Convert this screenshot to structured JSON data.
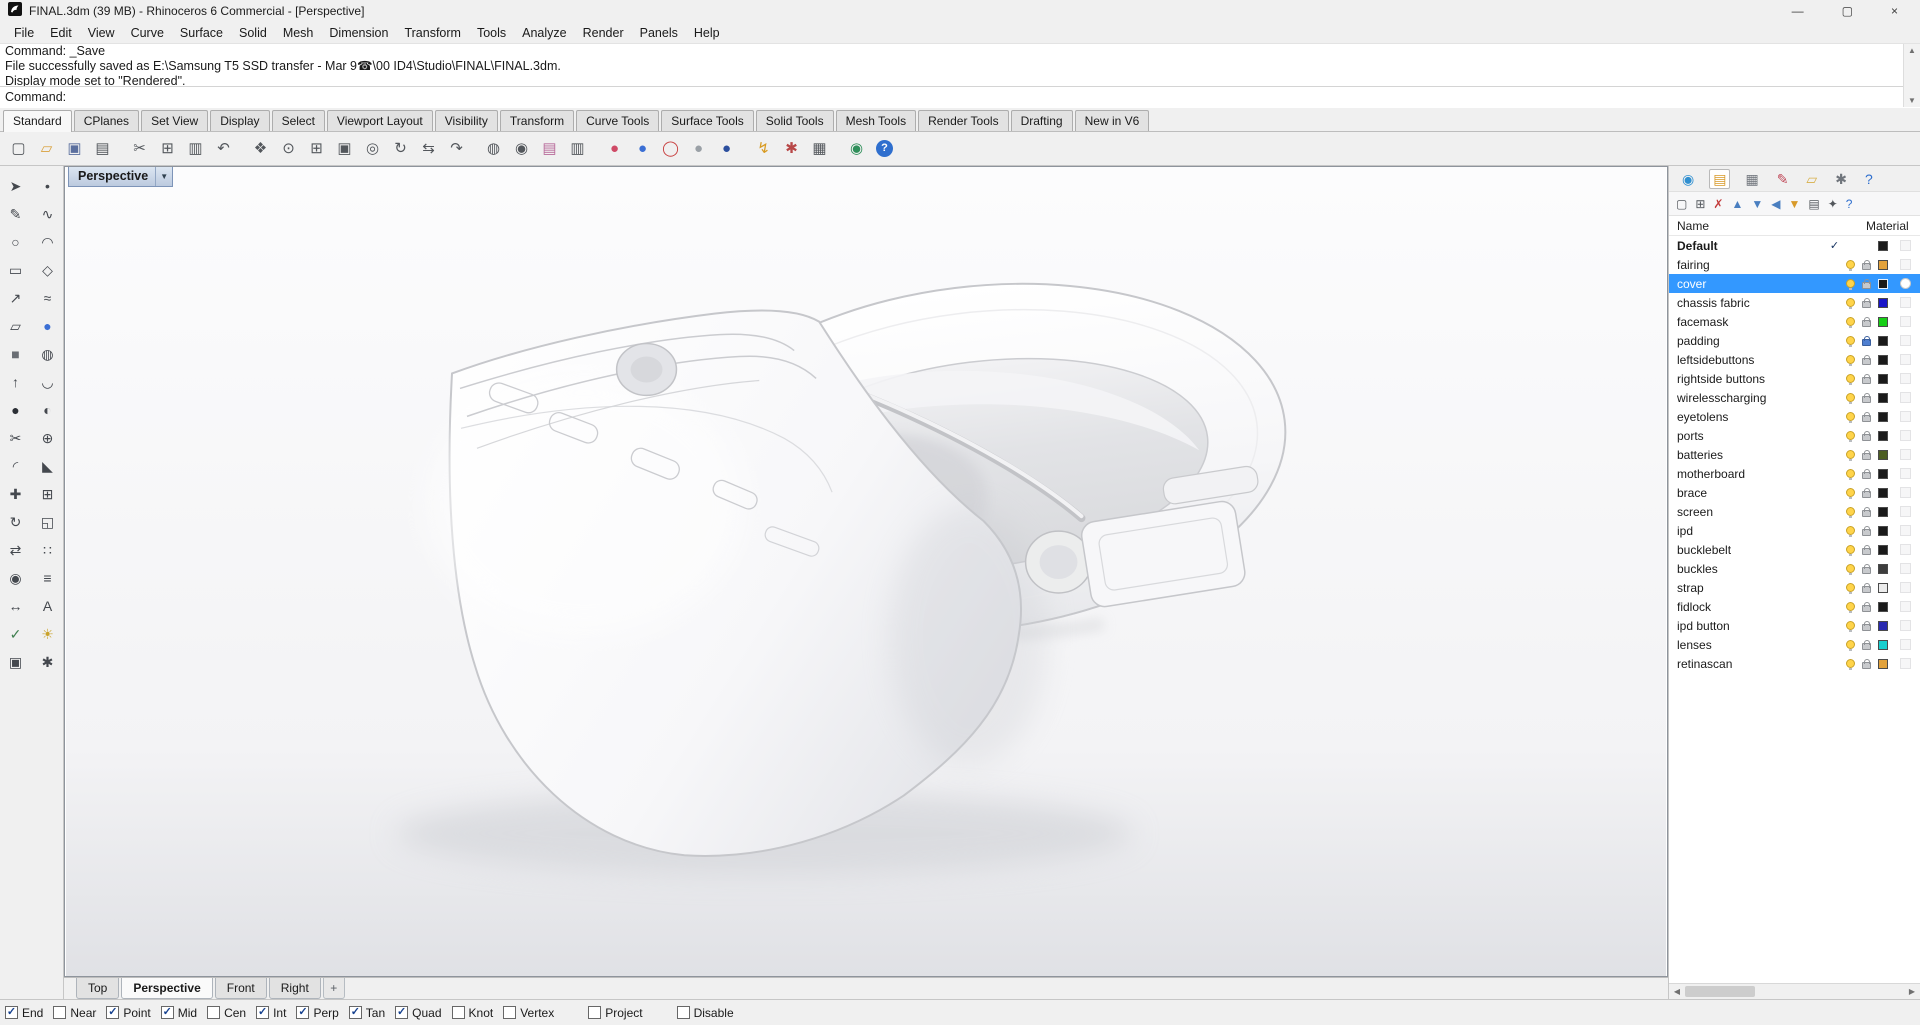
{
  "window": {
    "title": "FINAL.3dm (39 MB) - Rhinoceros 6 Commercial - [Perspective]",
    "minimize_glyph": "—",
    "maximize_glyph": "▢",
    "close_glyph": "×"
  },
  "menu": {
    "items": [
      {
        "name": "menu-file",
        "label": "File"
      },
      {
        "name": "menu-edit",
        "label": "Edit"
      },
      {
        "name": "menu-view",
        "label": "View"
      },
      {
        "name": "menu-curve",
        "label": "Curve"
      },
      {
        "name": "menu-surface",
        "label": "Surface"
      },
      {
        "name": "menu-solid",
        "label": "Solid"
      },
      {
        "name": "menu-mesh",
        "label": "Mesh"
      },
      {
        "name": "menu-dimension",
        "label": "Dimension"
      },
      {
        "name": "menu-transform",
        "label": "Transform"
      },
      {
        "name": "menu-tools",
        "label": "Tools"
      },
      {
        "name": "menu-analyze",
        "label": "Analyze"
      },
      {
        "name": "menu-render",
        "label": "Render"
      },
      {
        "name": "menu-panels",
        "label": "Panels"
      },
      {
        "name": "menu-help",
        "label": "Help"
      }
    ]
  },
  "command": {
    "history": [
      "Command: _Save",
      "File successfully saved as E:\\Samsung T5 SSD transfer - Mar 9☎\\00 ID4\\Studio\\FINAL\\FINAL.3dm.",
      "Display mode set to \"Rendered\"."
    ],
    "prompt": "Command:",
    "scroll_up_glyph": "▲",
    "scroll_down_glyph": "▼"
  },
  "tabbar": {
    "overflow_icon": "▦",
    "tabs": [
      {
        "name": "tab-standard",
        "label": "Standard",
        "active": true
      },
      {
        "name": "tab-cplanes",
        "label": "CPlanes"
      },
      {
        "name": "tab-set-view",
        "label": "Set View"
      },
      {
        "name": "tab-display",
        "label": "Display"
      },
      {
        "name": "tab-select",
        "label": "Select"
      },
      {
        "name": "tab-viewport-layout",
        "label": "Viewport Layout"
      },
      {
        "name": "tab-visibility",
        "label": "Visibility"
      },
      {
        "name": "tab-transform",
        "label": "Transform"
      },
      {
        "name": "tab-curve-tools",
        "label": "Curve Tools"
      },
      {
        "name": "tab-surface-tools",
        "label": "Surface Tools"
      },
      {
        "name": "tab-solid-tools",
        "label": "Solid Tools"
      },
      {
        "name": "tab-mesh-tools",
        "label": "Mesh Tools"
      },
      {
        "name": "tab-render-tools",
        "label": "Render Tools"
      },
      {
        "name": "tab-drafting",
        "label": "Drafting"
      },
      {
        "name": "tab-new-in-v6",
        "label": "New in V6"
      }
    ]
  },
  "toolbar": {
    "icons": [
      {
        "name": "new-file-icon",
        "glyph": "▢",
        "color": "#53575c"
      },
      {
        "name": "open-file-icon",
        "glyph": "▱",
        "color": "#d9a23e"
      },
      {
        "name": "save-file-icon",
        "glyph": "▣",
        "color": "#5b6f9e"
      },
      {
        "name": "print-icon",
        "glyph": "▤",
        "color": "#53575c"
      },
      {
        "name": "cut-icon",
        "glyph": "✂",
        "color": "#53575c",
        "sep": true
      },
      {
        "name": "copy-icon",
        "glyph": "⊞",
        "color": "#53575c"
      },
      {
        "name": "paste-icon",
        "glyph": "▥",
        "color": "#53575c"
      },
      {
        "name": "undo-icon",
        "glyph": "↶",
        "color": "#53575c"
      },
      {
        "name": "pan-icon",
        "glyph": "❖",
        "color": "#53575c",
        "sep": true
      },
      {
        "name": "zoom-dynamic-icon",
        "glyph": "⊙",
        "color": "#53575c"
      },
      {
        "name": "zoom-window-icon",
        "glyph": "⊞",
        "color": "#53575c"
      },
      {
        "name": "zoom-extents-icon",
        "glyph": "▣",
        "color": "#53575c"
      },
      {
        "name": "zoom-selected-icon",
        "glyph": "◎",
        "color": "#53575c"
      },
      {
        "name": "rotate-view-icon",
        "glyph": "↻",
        "color": "#53575c"
      },
      {
        "name": "pan-view-icon",
        "glyph": "⇆",
        "color": "#53575c"
      },
      {
        "name": "undo-view-icon",
        "glyph": "↷",
        "color": "#53575c"
      },
      {
        "name": "hide-objects-icon",
        "glyph": "◍",
        "color": "#53575c",
        "sep": true
      },
      {
        "name": "lock-objects-icon",
        "glyph": "◉",
        "color": "#53575c"
      },
      {
        "name": "layer-dialog-icon",
        "glyph": "▤",
        "color": "#b86a9a"
      },
      {
        "name": "object-properties-icon",
        "glyph": "▥",
        "color": "#53575c"
      },
      {
        "name": "render-icon",
        "glyph": "●",
        "color": "#cf4a66",
        "sep": true
      },
      {
        "name": "render-preview-icon",
        "glyph": "●",
        "color": "#3b6fd4"
      },
      {
        "name": "render-region-icon",
        "glyph": "◯",
        "color": "#c84040"
      },
      {
        "name": "shaded-mode-icon",
        "glyph": "●",
        "color": "#9aa0a6"
      },
      {
        "name": "ghosted-mode-icon",
        "glyph": "●",
        "color": "#2c4f9e"
      },
      {
        "name": "flash-render-icon",
        "glyph": "↯",
        "color": "#d89a20",
        "sep": true
      },
      {
        "name": "options-gear-icon",
        "glyph": "✱",
        "color": "#b84848"
      },
      {
        "name": "grid-snap-icon",
        "glyph": "▦",
        "color": "#53575c"
      },
      {
        "name": "web-browser-globe-icon",
        "glyph": "◉",
        "color": "#2f8f5a",
        "sep": true
      },
      {
        "name": "help-icon",
        "glyph": "?",
        "color": "#ffffff",
        "badge": true
      }
    ]
  },
  "left_toolbar": {
    "icons": [
      {
        "name": "select-icon",
        "glyph": "➤",
        "color": "#44484e"
      },
      {
        "name": "point-icon",
        "glyph": "•",
        "color": "#44484e"
      },
      {
        "name": "polyline-icon",
        "glyph": "✎",
        "color": "#44484e"
      },
      {
        "name": "curve-icon",
        "glyph": "∿",
        "color": "#44484e"
      },
      {
        "name": "circle-icon",
        "glyph": "○",
        "color": "#44484e"
      },
      {
        "name": "arc-icon",
        "glyph": "◠",
        "color": "#44484e"
      },
      {
        "name": "rectangle-icon",
        "glyph": "▭",
        "color": "#44484e"
      },
      {
        "name": "polygon-icon",
        "glyph": "◇",
        "color": "#44484e"
      },
      {
        "name": "curve-edit-icon",
        "glyph": "↗",
        "color": "#44484e"
      },
      {
        "name": "offset-icon",
        "glyph": "≈",
        "color": "#44484e"
      },
      {
        "name": "surface-icon",
        "glyph": "▱",
        "color": "#44484e"
      },
      {
        "name": "sphere-icon",
        "glyph": "●",
        "color": "#3b6fd4"
      },
      {
        "name": "box-icon",
        "glyph": "■",
        "color": "#6a6e74"
      },
      {
        "name": "cylinder-icon",
        "glyph": "◍",
        "color": "#44484e"
      },
      {
        "name": "extrude-icon",
        "glyph": "↑",
        "color": "#44484e"
      },
      {
        "name": "loft-icon",
        "glyph": "◡",
        "color": "#44484e"
      },
      {
        "name": "boolean-icon",
        "glyph": "●",
        "color": "#2b2f35"
      },
      {
        "name": "split-icon",
        "glyph": "◐",
        "color": "#44484e"
      },
      {
        "name": "trim-icon",
        "glyph": "✂",
        "color": "#44484e"
      },
      {
        "name": "join-icon",
        "glyph": "⊕",
        "color": "#44484e"
      },
      {
        "name": "fillet-icon",
        "glyph": "◜",
        "color": "#44484e"
      },
      {
        "name": "chamfer-icon",
        "glyph": "◣",
        "color": "#44484e"
      },
      {
        "name": "move-icon",
        "glyph": "✚",
        "color": "#44484e"
      },
      {
        "name": "copy-object-icon",
        "glyph": "⊞",
        "color": "#44484e"
      },
      {
        "name": "rotate-icon",
        "glyph": "↻",
        "color": "#44484e"
      },
      {
        "name": "scale-icon",
        "glyph": "◱",
        "color": "#44484e"
      },
      {
        "name": "mirror-icon",
        "glyph": "⇄",
        "color": "#44484e"
      },
      {
        "name": "array-icon",
        "glyph": "∷",
        "color": "#44484e"
      },
      {
        "name": "gumball-icon",
        "glyph": "◉",
        "color": "#44484e"
      },
      {
        "name": "align-icon",
        "glyph": "≡",
        "color": "#44484e"
      },
      {
        "name": "dimension-icon",
        "glyph": "↔",
        "color": "#44484e"
      },
      {
        "name": "text-icon",
        "glyph": "A",
        "color": "#44484e"
      },
      {
        "name": "visibility-check-icon",
        "glyph": "✓",
        "color": "#3f7f4f"
      },
      {
        "name": "lamp-icon",
        "glyph": "☀",
        "color": "#c9a22a"
      },
      {
        "name": "group-icon",
        "glyph": "▣",
        "color": "#44484e"
      },
      {
        "name": "explode-icon",
        "glyph": "✱",
        "color": "#44484e"
      }
    ]
  },
  "viewport": {
    "label": "Perspective",
    "dropdown_glyph": "▼"
  },
  "layers_panel": {
    "current_glyph": "✓",
    "columns": {
      "name": "Name",
      "material": "Material"
    },
    "panel_tabs": [
      {
        "name": "properties-tab",
        "glyph": "◉",
        "color": "#2f8fd0"
      },
      {
        "name": "layers-tab",
        "glyph": "▤",
        "color": "#d89a2a",
        "active": true
      },
      {
        "name": "display-tab",
        "glyph": "▦",
        "color": "#70757c"
      },
      {
        "name": "rendering-tab",
        "glyph": "✎",
        "color": "#c04a5a"
      },
      {
        "name": "libraries-tab",
        "glyph": "▱",
        "color": "#d8b04a"
      },
      {
        "name": "settings-tab",
        "glyph": "✱",
        "color": "#70757c"
      },
      {
        "name": "panel-help-tab",
        "glyph": "?",
        "color": "#2f6fce"
      }
    ],
    "toolbar_icons": [
      {
        "name": "new-layer-button",
        "glyph": "▢",
        "color": "#53575c"
      },
      {
        "name": "new-sublayer-button",
        "glyph": "⊞",
        "color": "#53575c"
      },
      {
        "name": "delete-layer-button",
        "glyph": "✗",
        "color": "#c23a3a"
      },
      {
        "name": "move-up-button",
        "glyph": "▲",
        "color": "#4a7fc0"
      },
      {
        "name": "move-down-button",
        "glyph": "▼",
        "color": "#4a7fc0"
      },
      {
        "name": "collapse-button",
        "glyph": "◀",
        "color": "#4a7fc0"
      },
      {
        "name": "filter-button",
        "glyph": "▼",
        "color": "#d89a2a"
      },
      {
        "name": "layer-state-button",
        "glyph": "▤",
        "color": "#53575c"
      },
      {
        "name": "layer-tools-button",
        "glyph": "✦",
        "color": "#53575c"
      },
      {
        "name": "layer-help-button",
        "glyph": "?",
        "color": "#2f6fce"
      }
    ],
    "layers": [
      {
        "name": "Default",
        "color": "#1a1a1a",
        "current": true,
        "bold": true
      },
      {
        "name": "fairing",
        "color": "#e2a23c"
      },
      {
        "name": "cover",
        "color": "#1a1a1a",
        "selected": true,
        "material_white": true
      },
      {
        "name": "chassis fabric",
        "color": "#1a16c8"
      },
      {
        "name": "facemask",
        "color": "#17cf17"
      },
      {
        "name": "padding",
        "color": "#1a1a1a",
        "locked": true
      },
      {
        "name": "leftsidebuttons",
        "color": "#1a1a1a"
      },
      {
        "name": "rightside buttons",
        "color": "#1a1a1a"
      },
      {
        "name": "wirelesscharging",
        "color": "#1a1a1a"
      },
      {
        "name": "eyetolens",
        "color": "#1a1a1a"
      },
      {
        "name": "ports",
        "color": "#1a1a1a"
      },
      {
        "name": "batteries",
        "color": "#4d5e23"
      },
      {
        "name": "motherboard",
        "color": "#1a1a1a"
      },
      {
        "name": "brace",
        "color": "#1a1a1a"
      },
      {
        "name": "screen",
        "color": "#1a1a1a"
      },
      {
        "name": "ipd",
        "color": "#1a1a1a"
      },
      {
        "name": "bucklebelt",
        "color": "#1a1a1a"
      },
      {
        "name": "buckles",
        "color": "#3d3d3d"
      },
      {
        "name": "strap",
        "color": "#ececec"
      },
      {
        "name": "fidlock",
        "color": "#1a1a1a"
      },
      {
        "name": "ipd button",
        "color": "#2a2ab0"
      },
      {
        "name": "lenses",
        "color": "#19cfcf"
      },
      {
        "name": "retinascan",
        "color": "#e2a23c"
      }
    ],
    "hscroll_left_glyph": "◀",
    "hscroll_right_glyph": "▶"
  },
  "viewport_tabs": {
    "add_button": "+",
    "tabs": [
      {
        "name": "vp-tab-top",
        "label": "Top"
      },
      {
        "name": "vp-tab-perspective",
        "label": "Perspective",
        "active": true
      },
      {
        "name": "vp-tab-front",
        "label": "Front"
      },
      {
        "name": "vp-tab-right",
        "label": "Right"
      }
    ]
  },
  "statusbar": {
    "check_glyph": "✓",
    "osnaps": [
      {
        "name": "osnap-end",
        "label": "End",
        "checked": true
      },
      {
        "name": "osnap-near",
        "label": "Near",
        "checked": false
      },
      {
        "name": "osnap-point",
        "label": "Point",
        "checked": true
      },
      {
        "name": "osnap-mid",
        "label": "Mid",
        "checked": true
      },
      {
        "name": "osnap-cen",
        "label": "Cen",
        "checked": false
      },
      {
        "name": "osnap-int",
        "label": "Int",
        "checked": true
      },
      {
        "name": "osnap-perp",
        "label": "Perp",
        "checked": true
      },
      {
        "name": "osnap-tan",
        "label": "Tan",
        "checked": true
      },
      {
        "name": "osnap-quad",
        "label": "Quad",
        "checked": true
      },
      {
        "name": "osnap-knot",
        "label": "Knot",
        "checked": false
      },
      {
        "name": "osnap-vertex",
        "label": "Vertex",
        "checked": false
      },
      {
        "name": "osnap-project",
        "label": "Project",
        "checked": false,
        "gap": true
      },
      {
        "name": "osnap-disable",
        "label": "Disable",
        "checked": false,
        "gap": true
      }
    ]
  }
}
